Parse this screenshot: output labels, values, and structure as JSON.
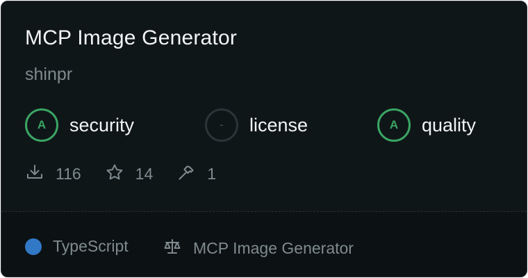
{
  "card": {
    "title": "MCP Image Generator",
    "author": "shinpr"
  },
  "grades": [
    {
      "grade": "A",
      "label": "security",
      "status": "graded"
    },
    {
      "grade": "-",
      "label": "license",
      "status": "ungraded"
    },
    {
      "grade": "A",
      "label": "quality",
      "status": "graded"
    }
  ],
  "stats": {
    "downloads": "116",
    "stars": "14",
    "tools": "1"
  },
  "footer": {
    "language": "TypeScript",
    "language_color": "#3178c6",
    "license": "MCP Image Generator"
  },
  "icons": {
    "downloads": "download-icon",
    "stars": "star-icon",
    "tools": "hammer-icon",
    "license": "scale-icon"
  },
  "colors": {
    "background": "#0f1618",
    "grade_green": "#3aa564",
    "muted_text": "#7f8b8f"
  }
}
